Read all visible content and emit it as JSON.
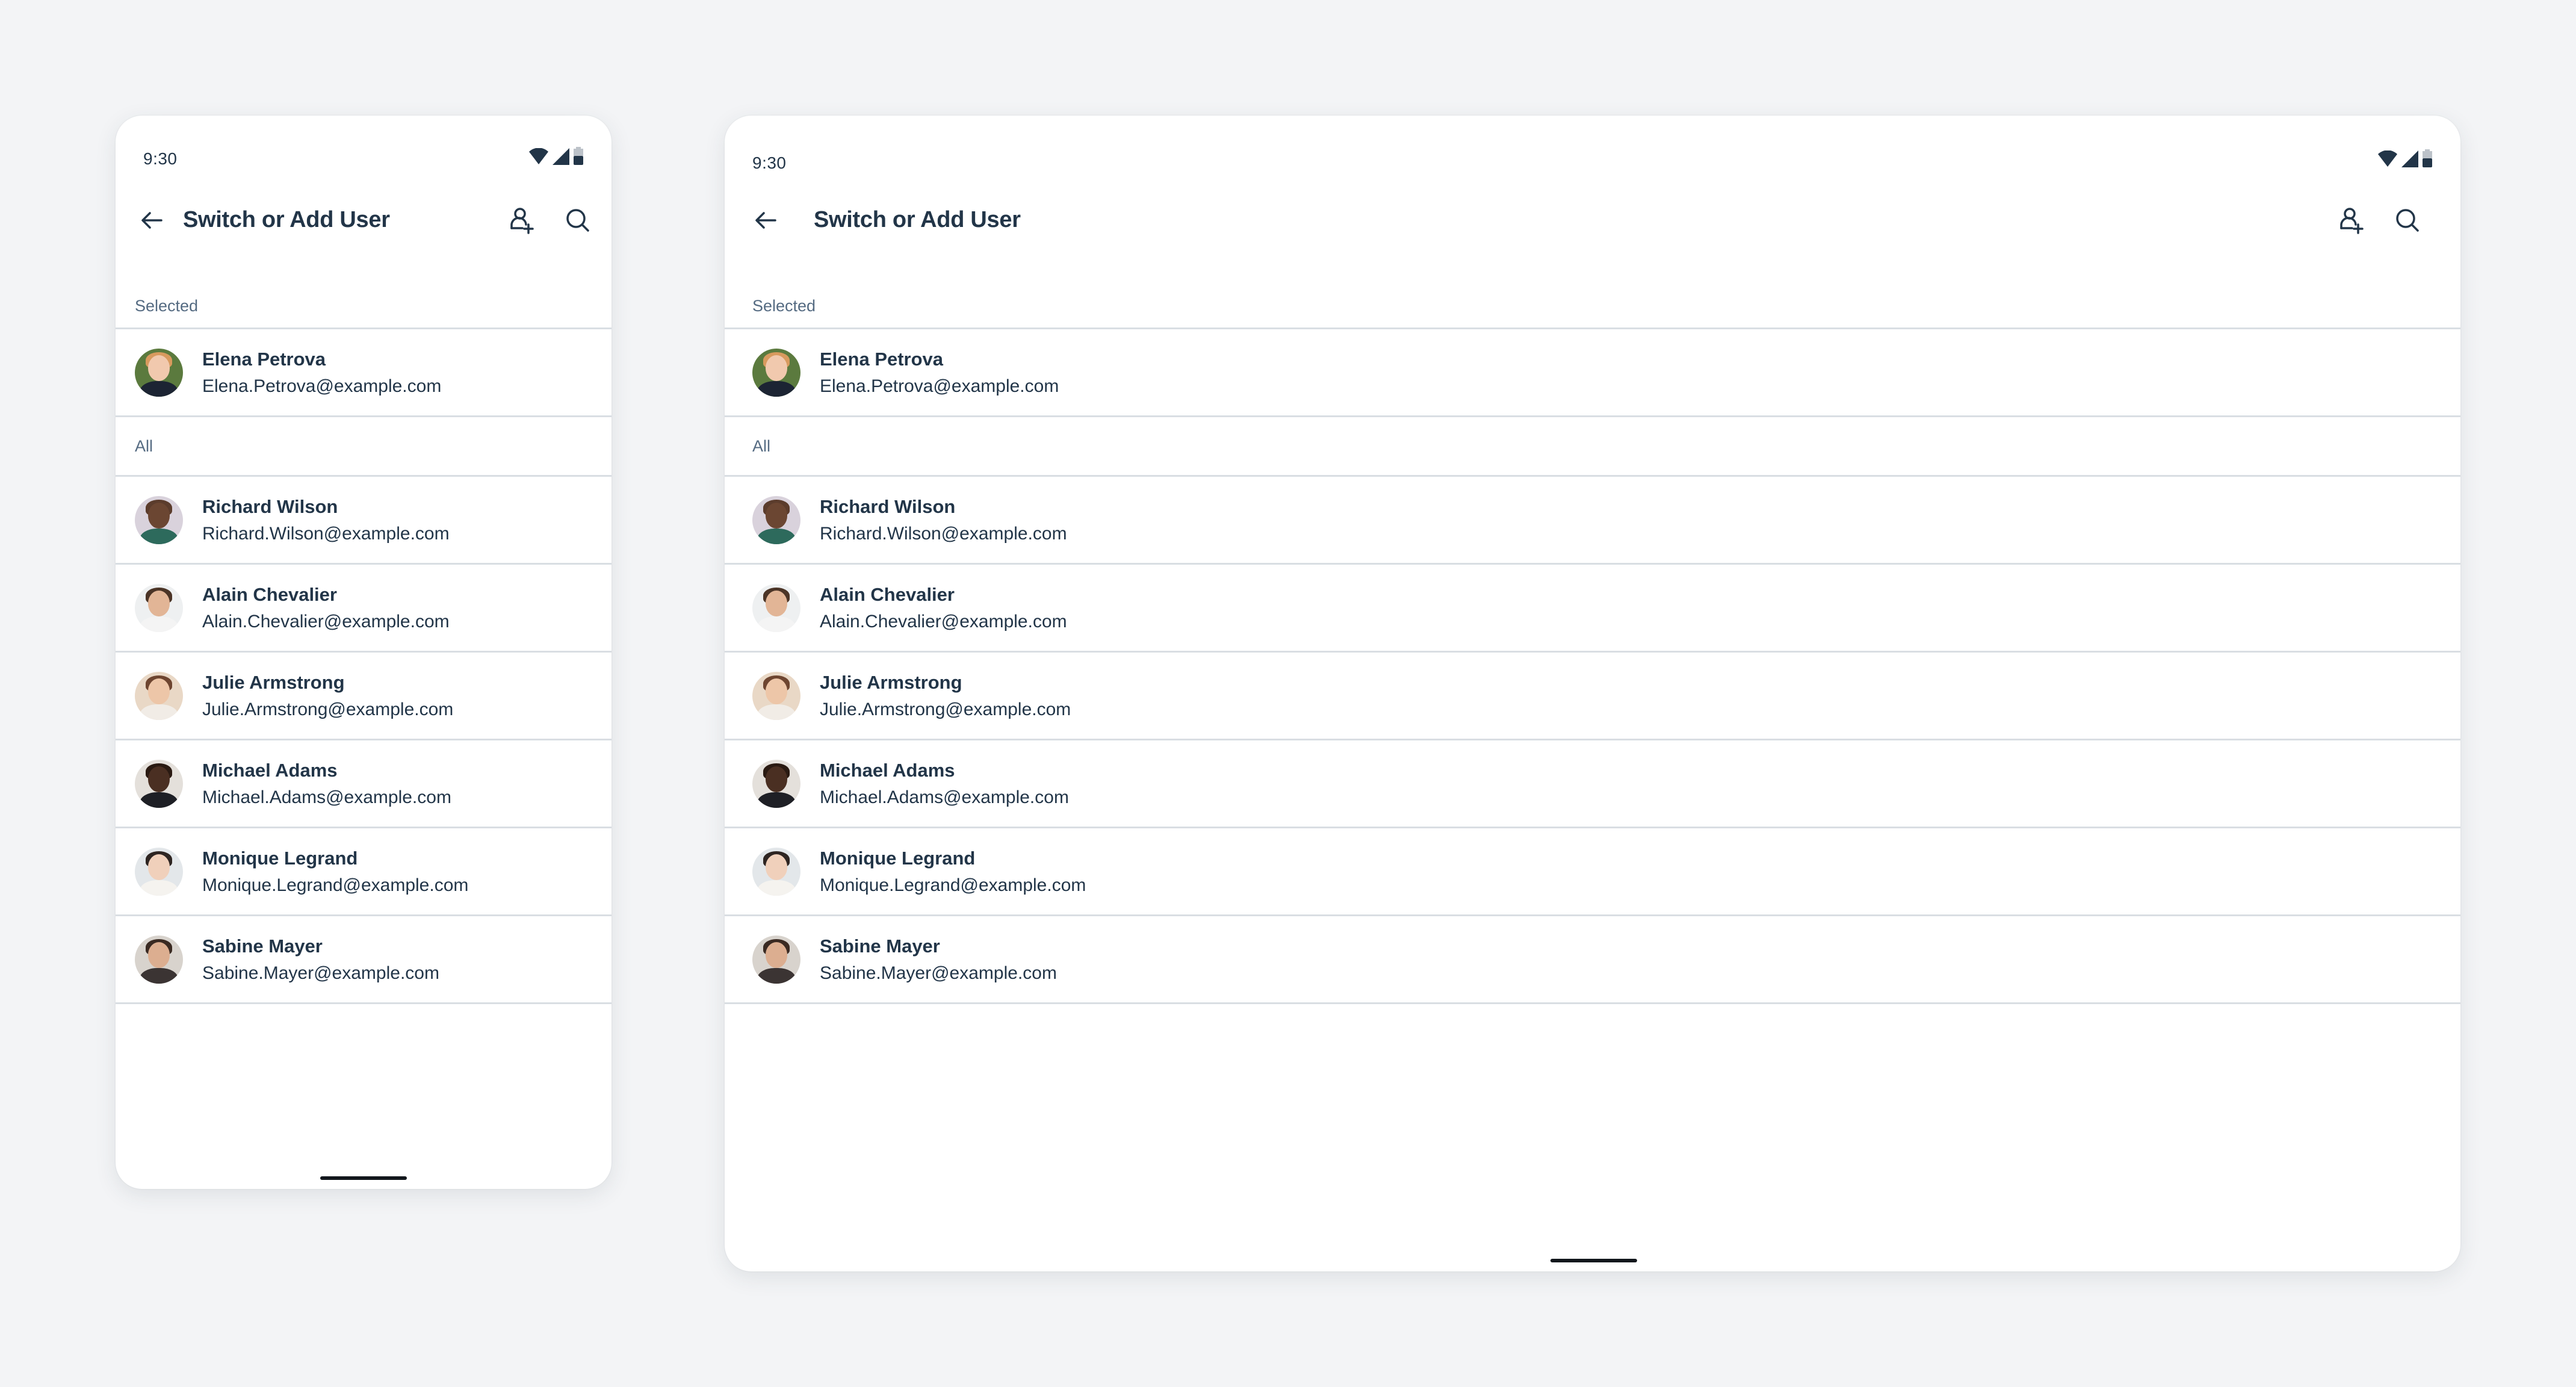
{
  "status_bar": {
    "time": "9:30",
    "icons": [
      "wifi-icon",
      "cellular-signal-icon",
      "battery-icon"
    ]
  },
  "app_bar": {
    "back_icon": "arrow-left-icon",
    "title": "Switch or Add User",
    "actions": [
      {
        "name": "add-user",
        "icon": "person-add-icon"
      },
      {
        "name": "search",
        "icon": "search-icon"
      }
    ]
  },
  "sections": {
    "selected_label": "Selected",
    "all_label": "All"
  },
  "selected_user": {
    "name": "Elena Petrova",
    "email": "Elena.Petrova@example.com",
    "avatar": {
      "bg": "#5b7a3e",
      "skin": "#f1c9ae",
      "hair": "#d89a5e",
      "shirt": "#1c2433"
    }
  },
  "users": [
    {
      "name": "Richard Wilson",
      "email": "Richard.Wilson@example.com",
      "avatar": {
        "bg": "#d9d2dc",
        "skin": "#6b4632",
        "hair": "#5b3c2c",
        "shirt": "#2d6a5c"
      }
    },
    {
      "name": "Alain Chevalier",
      "email": "Alain.Chevalier@example.com",
      "avatar": {
        "bg": "#eef0f1",
        "skin": "#e2b596",
        "hair": "#4b3426",
        "shirt": "#f4f4f4"
      }
    },
    {
      "name": "Julie Armstrong",
      "email": "Julie.Armstrong@example.com",
      "avatar": {
        "bg": "#e9d8c6",
        "skin": "#edc6a8",
        "hair": "#6e4530",
        "shirt": "#f1ece6"
      }
    },
    {
      "name": "Michael Adams",
      "email": "Michael.Adams@example.com",
      "avatar": {
        "bg": "#e4e0db",
        "skin": "#4a2f22",
        "hair": "#2a1a12",
        "shirt": "#1e1f25"
      }
    },
    {
      "name": "Monique Legrand",
      "email": "Monique.Legrand@example.com",
      "avatar": {
        "bg": "#e3e7ea",
        "skin": "#f0d0bb",
        "hair": "#2e2522",
        "shirt": "#f5f3ef"
      }
    },
    {
      "name": "Sabine Mayer",
      "email": "Sabine.Mayer@example.com",
      "avatar": {
        "bg": "#d8d3cd",
        "skin": "#dcae90",
        "hair": "#3a2a22",
        "shirt": "#3b3433"
      }
    }
  ],
  "colors": {
    "text_primary": "#223548",
    "text_secondary": "#556b82",
    "divider": "#d9dee3",
    "page_bg": "#f3f4f6",
    "surface": "#ffffff"
  }
}
